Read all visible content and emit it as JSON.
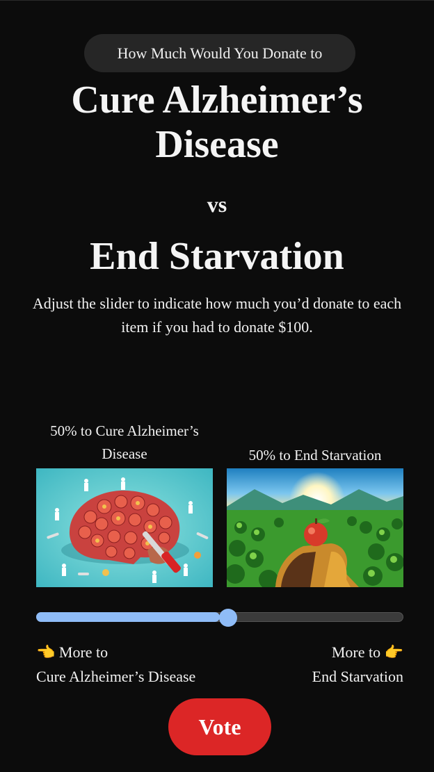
{
  "header": {
    "prompt": "How Much Would You Donate to"
  },
  "option_a": {
    "title": "Cure Alzheimer’s Disease",
    "caption": "50% to Cure Alzheimer’s Disease",
    "more_prefix": "More to",
    "more_name": "Cure Alzheimer’s Disease",
    "percent": 50
  },
  "versus": "vs",
  "option_b": {
    "title": "End Starvation",
    "caption": "50% to End Starvation",
    "more_prefix": "More to",
    "more_name": "End Starvation",
    "percent": 50
  },
  "instructions": "Adjust the slider to indicate how much you’d donate to each item if you had to donate $100.",
  "slider": {
    "value_fraction": 0.5,
    "fill_color": "#8fbcf7",
    "track_color": "#3b3b3b"
  },
  "icons": {
    "left_pointer": "👈",
    "right_pointer": "👉"
  },
  "vote": {
    "label": "Vote",
    "color": "#dc2626"
  }
}
